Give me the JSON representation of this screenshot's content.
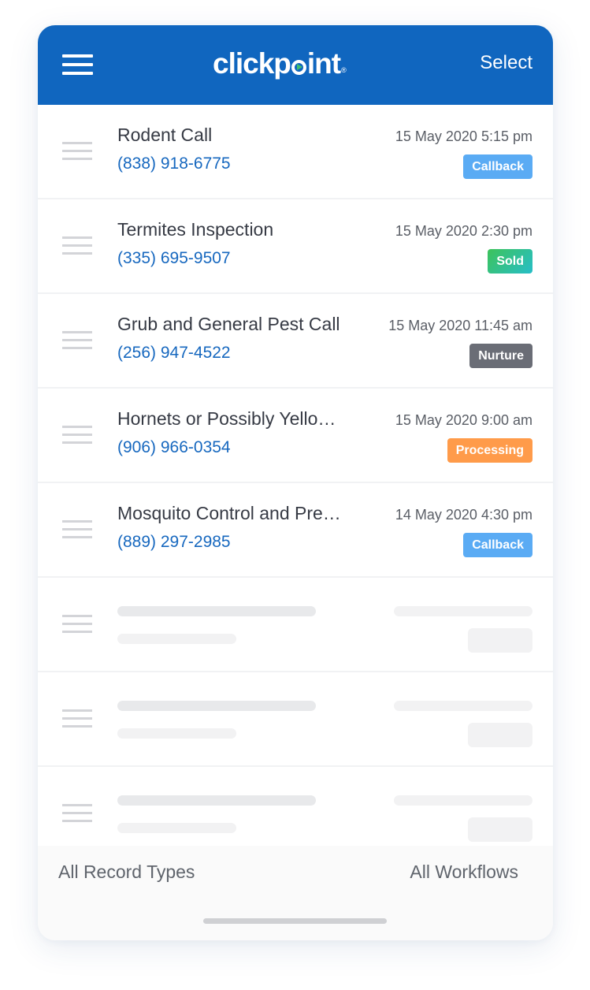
{
  "header": {
    "logo_text_pre": "clickp",
    "logo_text_post": "int",
    "logo_reg": "®",
    "select_label": "Select",
    "menu_icon": "hamburger-menu-icon",
    "brand_color": "#1066bf"
  },
  "records": [
    {
      "title": "Rodent Call",
      "phone": "(838) 918-6775",
      "date": "15 May 2020 5:15 pm",
      "status": "Callback",
      "status_color": "#5aabf4"
    },
    {
      "title": "Termites Inspection",
      "phone": "(335) 695-9507",
      "date": "15 May 2020 2:30 pm",
      "status": "Sold",
      "status_color": "linear-gradient(135deg, #3dc35a, #27bec8)"
    },
    {
      "title": "Grub and General Pest Call",
      "phone": "(256) 947-4522",
      "date": "15 May 2020 11:45 am",
      "status": "Nurture",
      "status_color": "#6a6d76"
    },
    {
      "title": "Hornets or Possibly Yello…",
      "phone": "(906) 966-0354",
      "date": "15 May 2020 9:00 am",
      "status": "Processing",
      "status_color": "#ff9b4a"
    },
    {
      "title": "Mosquito Control and Pre…",
      "phone": "(889) 297-2985",
      "date": "14 May 2020 4:30 pm",
      "status": "Callback",
      "status_color": "#5aabf4"
    }
  ],
  "placeholder_rows": 3,
  "footer": {
    "record_types_label": "All Record Types",
    "workflows_label": "All Workflows"
  }
}
